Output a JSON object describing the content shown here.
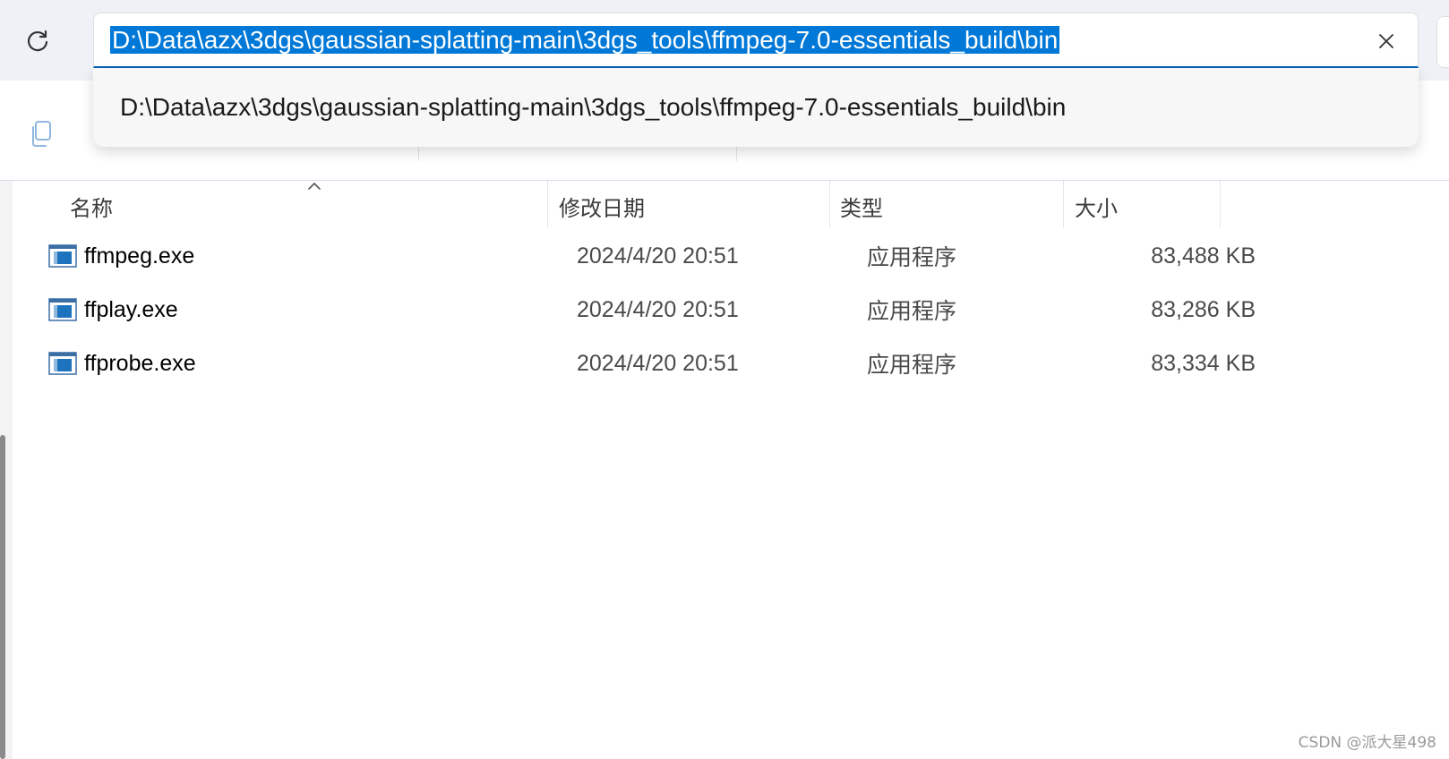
{
  "address": {
    "value": "D:\\Data\\azx\\3dgs\\gaussian-splatting-main\\3dgs_tools\\ffmpeg-7.0-essentials_build\\bin",
    "suggestion": "D:\\Data\\azx\\3dgs\\gaussian-splatting-main\\3dgs_tools\\ffmpeg-7.0-essentials_build\\bin",
    "selection_color": "#0078d7",
    "focus_color": "#005fb8"
  },
  "icons": {
    "refresh": "refresh-icon",
    "clear": "close-icon",
    "copy": "copy-icon",
    "file": "application-icon",
    "sort": "sort-up-icon"
  },
  "columns": {
    "name": "名称",
    "date": "修改日期",
    "type": "类型",
    "size": "大小"
  },
  "files": [
    {
      "name": "ffmpeg.exe",
      "date": "2024/4/20 20:51",
      "type": "应用程序",
      "size": "83,488 KB"
    },
    {
      "name": "ffplay.exe",
      "date": "2024/4/20 20:51",
      "type": "应用程序",
      "size": "83,286 KB"
    },
    {
      "name": "ffprobe.exe",
      "date": "2024/4/20 20:51",
      "type": "应用程序",
      "size": "83,334 KB"
    }
  ],
  "watermark": "CSDN @派大星498"
}
